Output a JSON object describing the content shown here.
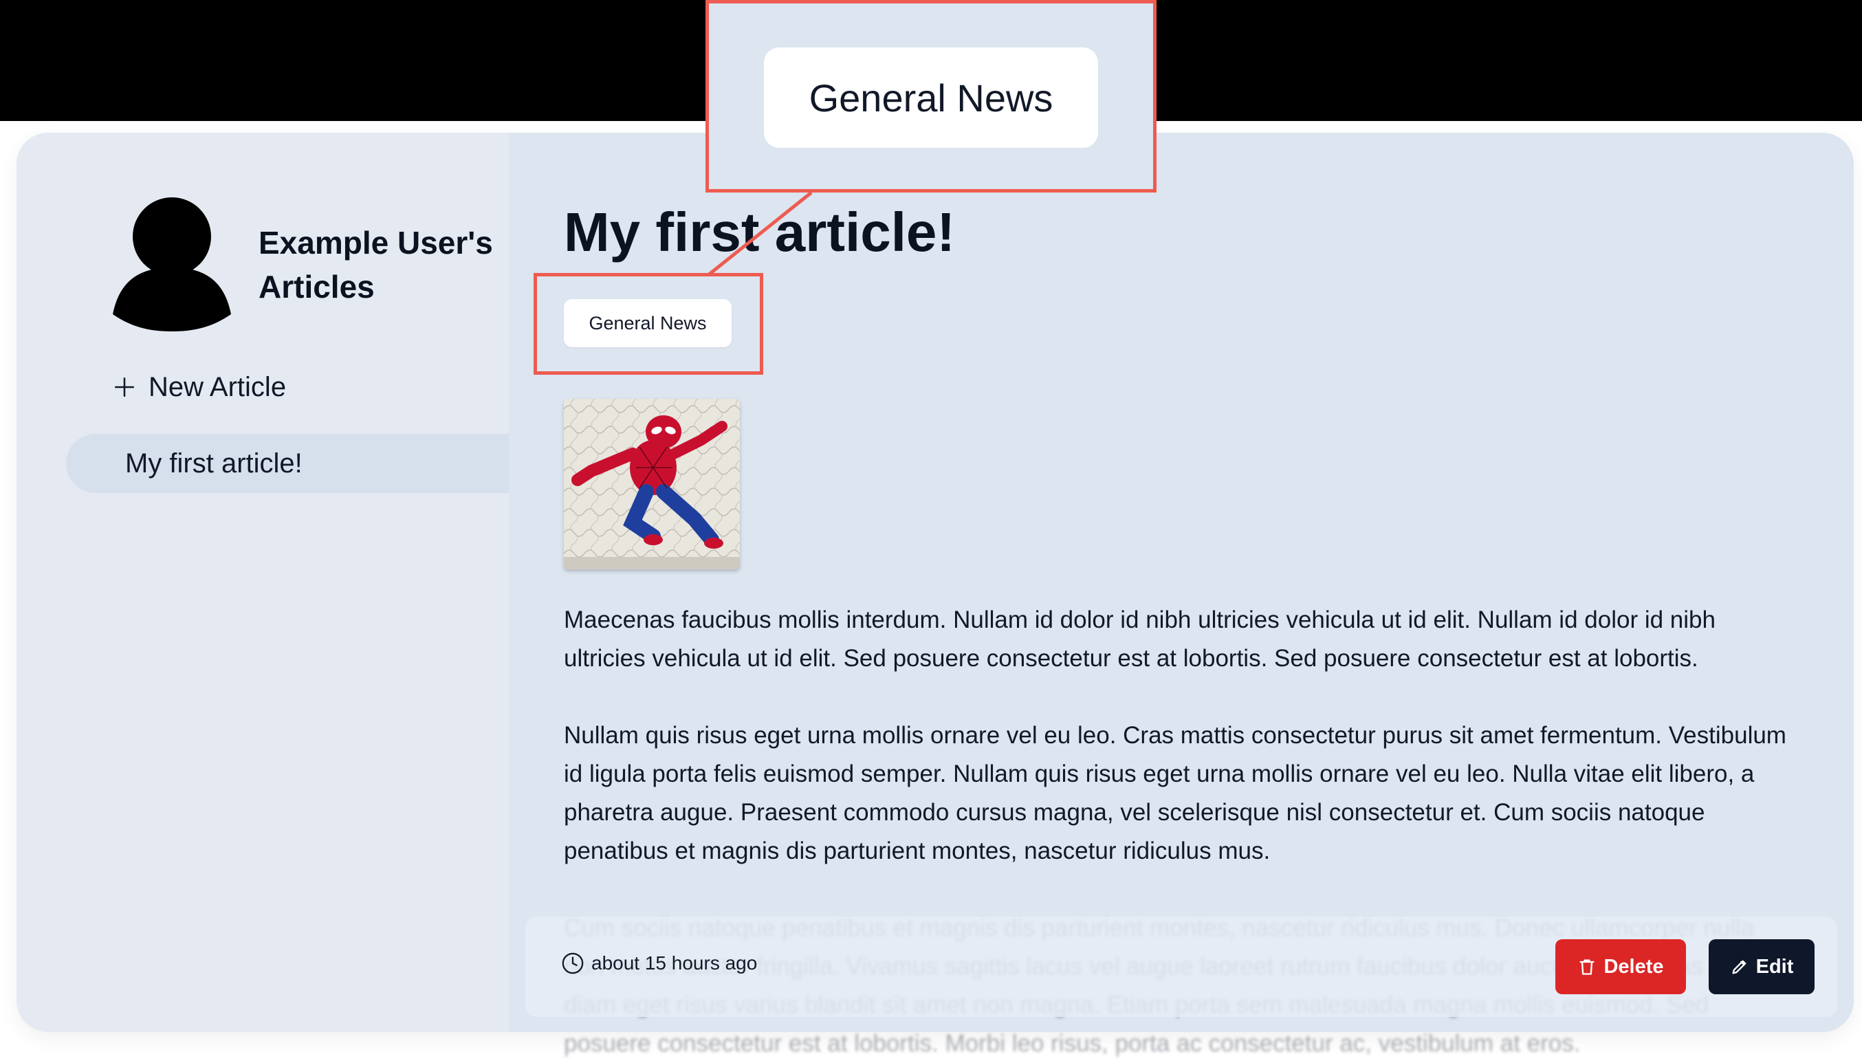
{
  "sidebar": {
    "title": "Example User's Articles",
    "new_article_label": "New Article",
    "articles": [
      {
        "label": "My first article!"
      }
    ]
  },
  "article": {
    "title": "My first article!",
    "tag": "General News",
    "image_alt": "Spider-Man",
    "paragraphs": [
      "Maecenas faucibus mollis interdum. Nullam id dolor id nibh ultricies vehicula ut id elit. Nullam id dolor id nibh ultricies vehicula ut id elit. Sed posuere consectetur est at lobortis. Sed posuere consectetur est at lobortis.",
      "Nullam quis risus eget urna mollis ornare vel eu leo. Cras mattis consectetur purus sit amet fermentum. Vestibulum id ligula porta felis euismod semper. Nullam quis risus eget urna mollis ornare vel eu leo. Nulla vitae elit libero, a pharetra augue. Praesent commodo cursus magna, vel scelerisque nisl consectetur et. Cum sociis natoque penatibus et magnis dis parturient montes, nascetur ridiculus mus.",
      "Cum sociis natoque penatibus et magnis dis parturient montes, nascetur ridiculus mus. Donec ullamcorper nulla non metus auctor fringilla. Vivamus sagittis lacus vel augue laoreet rutrum faucibus dolor auctor. Maecenas sed diam eget risus varius blandit sit amet non magna. Etiam porta sem malesuada magna mollis euismod. Sed posuere consectetur est at lobortis. Morbi leo risus, porta ac consectetur ac, vestibulum at eros."
    ]
  },
  "footer": {
    "timestamp": "about 15 hours ago",
    "delete_label": "Delete",
    "edit_label": "Edit"
  },
  "callout": {
    "label": "General News"
  },
  "colors": {
    "accent_callout": "#ee5b50",
    "delete": "#dc2626",
    "edit": "#0f172a",
    "background": "#dce5f0"
  },
  "icons": {
    "avatar": "user-silhouette-icon",
    "new_article": "plus-icon",
    "time": "clock-icon",
    "delete": "trash-icon",
    "edit": "pencil-icon"
  }
}
